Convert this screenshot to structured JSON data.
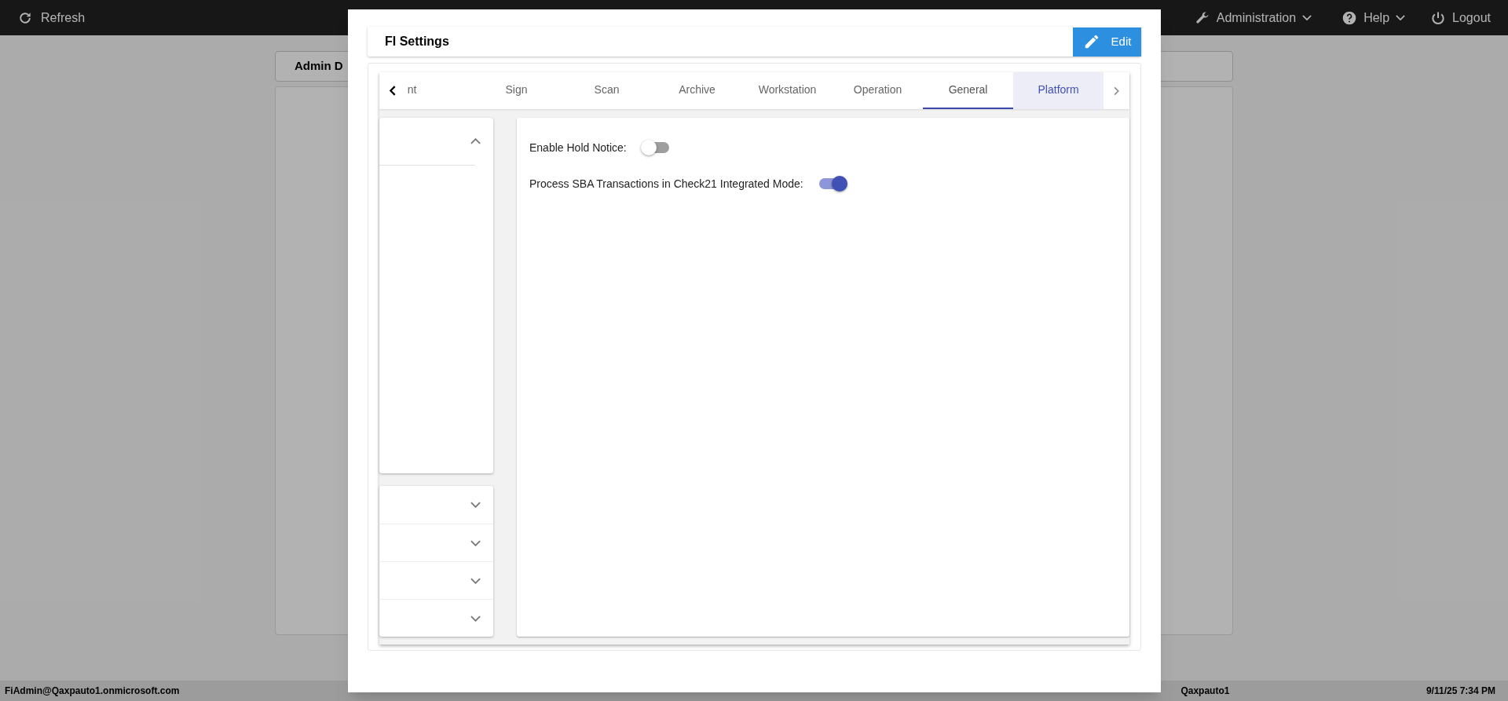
{
  "top_bar": {
    "refresh": "Refresh",
    "menus": [
      {
        "kind": "wrench",
        "label": "Administration",
        "dropdown": true
      },
      {
        "kind": "help",
        "label": "Help",
        "dropdown": true
      },
      {
        "kind": "power",
        "label": "Logout",
        "dropdown": false
      }
    ]
  },
  "background": {
    "card_title": "Admin D"
  },
  "status_bar": {
    "user": "FiAdmin@Qaxpauto1.onmicrosoft.com",
    "fi": "Qaxpauto1",
    "datetime": "9/11/25 7:34 PM"
  },
  "dialog": {
    "title": "FI Settings",
    "edit_button": "Edit",
    "tabs": [
      {
        "label": "nt",
        "selected": false,
        "hovered": false
      },
      {
        "label": "Sign",
        "selected": false,
        "hovered": false
      },
      {
        "label": "Scan",
        "selected": false,
        "hovered": false
      },
      {
        "label": "Archive",
        "selected": false,
        "hovered": false
      },
      {
        "label": "Workstation",
        "selected": false,
        "hovered": false
      },
      {
        "label": "Operation",
        "selected": false,
        "hovered": false
      },
      {
        "label": "General",
        "selected": true,
        "hovered": false
      },
      {
        "label": "Platform",
        "selected": false,
        "hovered": true
      }
    ],
    "sections": [
      {
        "expanded": true
      },
      {
        "expanded": false
      },
      {
        "expanded": false
      },
      {
        "expanded": false
      },
      {
        "expanded": false
      }
    ],
    "settings": [
      {
        "label": "Enable Hold Notice:",
        "on": false
      },
      {
        "label": "Process SBA Transactions in Check21 Integrated Mode:",
        "on": true
      }
    ]
  }
}
